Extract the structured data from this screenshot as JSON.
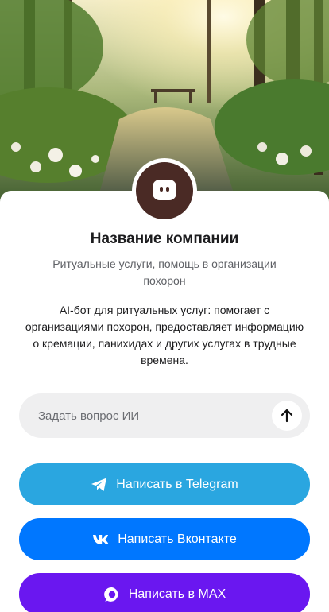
{
  "company": {
    "name": "Название компании",
    "subtitle": "Ритуальные услуги, помощь в организации похорон",
    "description": "AI-бот для ритуальных услуг: помогает с организациями похорон, предоставляет информацию о кремации, панихидах и других услугах в трудные времена."
  },
  "ask": {
    "placeholder": "Задать вопрос ИИ"
  },
  "buttons": {
    "telegram": "Написать в Telegram",
    "vk": "Написать Вконтакте",
    "max": "Написать в MAX"
  },
  "colors": {
    "telegram": "#2aa6e0",
    "vk": "#0077ff",
    "max": "#6a17f0",
    "avatar": "#4a2a25"
  },
  "icons": {
    "avatar": "chat-bot-icon",
    "send": "arrow-up-icon",
    "telegram": "telegram-icon",
    "vk": "vk-icon",
    "max": "max-icon"
  }
}
